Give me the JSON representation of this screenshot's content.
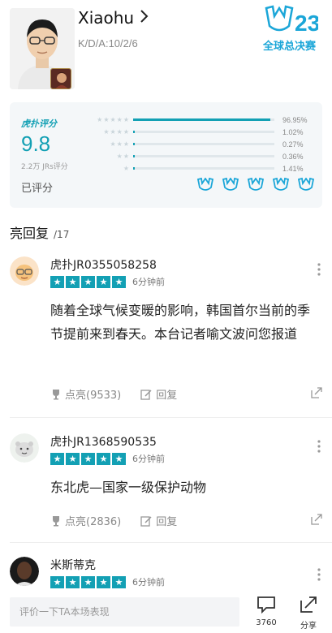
{
  "player": {
    "name": "Xiaohu",
    "chevron": "›",
    "kda": "K/D/A:10/2/6",
    "event_logo_text_top": "23",
    "event_logo_text": "全球总决赛"
  },
  "rating": {
    "brand": "虎扑评分",
    "score": "9.8",
    "count": "2.2万 JRs评分",
    "status": "已评分",
    "distribution": [
      {
        "stars": "★★★★★",
        "percent": "96.95%",
        "value": 96.95
      },
      {
        "stars": "★★★★",
        "percent": "1.02%",
        "value": 1.02
      },
      {
        "stars": "★★★",
        "percent": "0.27%",
        "value": 0.27
      },
      {
        "stars": "★★",
        "percent": "0.36%",
        "value": 0.36
      },
      {
        "stars": "★",
        "percent": "1.41%",
        "value": 1.41
      }
    ]
  },
  "section": {
    "title": "亮回复",
    "count": "/17"
  },
  "comments": [
    {
      "user": "虎扑JR0355058258",
      "time": "6分钟前",
      "text": "随着全球气候变暖的影响，韩国首尔当前的季节提前来到春天。本台记者喻文波问您报道",
      "likes": "点亮(9533)",
      "reply": "回复"
    },
    {
      "user": "虎扑JR1368590535",
      "time": "6分钟前",
      "text": "东北虎—国家一级保护动物",
      "likes": "点亮(2836)",
      "reply": "回复"
    },
    {
      "user": "米斯蒂克",
      "time": "6分钟前"
    }
  ],
  "bottom": {
    "placeholder": "评价一下TA本场表现",
    "comment_count": "3760",
    "share_label": "分享"
  },
  "colors": {
    "accent": "#13a0b4"
  }
}
